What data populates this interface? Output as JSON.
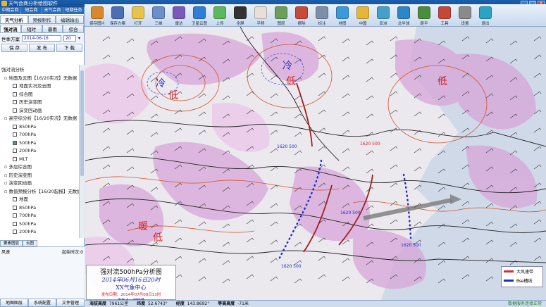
{
  "title": "天气会商分析绘图软件",
  "window_buttons": [
    "_",
    "□",
    "×"
  ],
  "menu": [
    "中期会商",
    "短会商",
    "天气会商",
    "短期任务"
  ],
  "toolbar": [
    {
      "label": "保存图片",
      "icon": "save-image-icon",
      "color": "#d9892b"
    },
    {
      "label": "保存方案",
      "icon": "save-scheme-icon",
      "color": "#4a6fb5"
    },
    {
      "label": "打开",
      "icon": "open-folder-icon",
      "color": "#e6c44a"
    },
    {
      "label": "三维",
      "icon": "3d-icon",
      "color": "#6c8fc9"
    },
    {
      "label": "雷达",
      "icon": "radar-icon",
      "color": "#7a5ab8"
    },
    {
      "label": "卫星云图",
      "icon": "satellite-icon",
      "color": "#2f7ed8"
    },
    {
      "label": "上传",
      "icon": "upload-icon",
      "color": "#5cb85c"
    },
    {
      "label": "全屏",
      "icon": "fullscreen-icon",
      "color": "#333"
    },
    {
      "label": "平移",
      "icon": "pan-hand-icon",
      "color": "#e8e0d8"
    },
    {
      "label": "图层",
      "icon": "layers-icon",
      "color": "#6a9e5a"
    },
    {
      "label": "擦除",
      "icon": "eraser-icon",
      "color": "#c84a3a"
    },
    {
      "label": "标注",
      "icon": "annotate-icon",
      "color": "#7b8fa8"
    },
    {
      "label": "地图",
      "icon": "map-icon",
      "color": "#3b9ad9"
    },
    {
      "label": "中国",
      "icon": "china-map-icon",
      "color": "#e4b73a"
    },
    {
      "label": "亚洲",
      "icon": "asia-map-icon",
      "color": "#44a0c8"
    },
    {
      "label": "北半球",
      "icon": "hemisphere-icon",
      "color": "#2c86c7"
    },
    {
      "label": "距平",
      "icon": "anomaly-icon",
      "color": "#4b8d3c"
    },
    {
      "label": "工具",
      "icon": "tools-icon",
      "color": "#c4473a"
    },
    {
      "label": "设置",
      "icon": "settings-icon",
      "color": "#8a8a8a"
    },
    {
      "label": "退出",
      "icon": "exit-icon",
      "color": "#2aa3c4"
    }
  ],
  "main_tabs": [
    "天气分析",
    "预报制作",
    "编辑输出"
  ],
  "sub_tabs": [
    "强对流",
    "短时",
    "暴雨",
    "综合"
  ],
  "date_label": "世季方案",
  "date_value": "2014-06-16",
  "hour_value": "20",
  "buttons": [
    "保 存",
    "发 布",
    "下 载"
  ],
  "tree": [
    {
      "level": 0,
      "text": "强对流分析"
    },
    {
      "level": 1,
      "text": "地面及云图【16/20实况】无数据"
    },
    {
      "level": 2,
      "text": "地面实况及云图",
      "on": false
    },
    {
      "level": 2,
      "text": "综合图",
      "on": false
    },
    {
      "level": 2,
      "text": "历史演变图",
      "on": false
    },
    {
      "level": 2,
      "text": "演变回动画",
      "on": false
    },
    {
      "level": 1,
      "text": "高空综分析【16/20实况】无数据"
    },
    {
      "level": 2,
      "text": "850hPa",
      "on": false
    },
    {
      "level": 2,
      "text": "700hPa",
      "on": false
    },
    {
      "level": 2,
      "text": "500hPa",
      "on": true
    },
    {
      "level": 2,
      "text": "200hPa",
      "on": false
    },
    {
      "level": 2,
      "text": "MLT",
      "on": false
    },
    {
      "level": 1,
      "text": "多层综合图"
    },
    {
      "level": 1,
      "text": "历史演变图"
    },
    {
      "level": 1,
      "text": "演变回动画"
    },
    {
      "level": 1,
      "text": "数值预报分析【16/20起报】无数据"
    },
    {
      "level": 2,
      "text": "地面",
      "on": false
    },
    {
      "level": 2,
      "text": "850hPa",
      "on": false
    },
    {
      "level": 2,
      "text": "700hPa",
      "on": false
    },
    {
      "level": 2,
      "text": "500hPa",
      "on": false
    },
    {
      "level": 2,
      "text": "200hPa",
      "on": false
    }
  ],
  "prop_tabs": [
    "要素图层",
    "云图"
  ],
  "prop_row": {
    "left": "风速",
    "right": "起始时次:0"
  },
  "bottom_buttons": [
    "地图图层",
    "系统配置",
    "文件管理"
  ],
  "map": {
    "labels": [
      {
        "text": "冷",
        "color": "#1a2ec8",
        "size": 14
      },
      {
        "text": "低",
        "color": "#d22",
        "size": 14
      },
      {
        "text": "冷",
        "color": "#1a2ec8",
        "size": 14
      },
      {
        "text": "低",
        "color": "#d22",
        "size": 14
      },
      {
        "text": "低",
        "color": "#d22",
        "size": 14
      },
      {
        "text": "暖",
        "color": "#d22",
        "size": 14
      },
      {
        "text": "低",
        "color": "#d22",
        "size": 14
      },
      {
        "text": "1620 500",
        "color": "#1a2ec8",
        "size": 6
      },
      {
        "text": "1620 500",
        "color": "#d22",
        "size": 6
      },
      {
        "text": "1620 500",
        "color": "#1a2ec8",
        "size": 6
      },
      {
        "text": "1620 500",
        "color": "#1a2ec8",
        "size": 6
      },
      {
        "text": "1620 500",
        "color": "#1a2ec8",
        "size": 6
      }
    ]
  },
  "caption": {
    "line1": "强对流500hPa分析图",
    "line2": "2014年06月16日20时",
    "line3": "XX气象中心",
    "line4": "发布日期：2014年07月08日13时",
    "line5": "发布人：刘晓燕"
  },
  "legend": [
    {
      "text": "大风速带",
      "color": "#d03030"
    },
    {
      "text": "θse槽线",
      "color": "#1a2ec8"
    }
  ],
  "status": {
    "alt_label": "海拔高度",
    "alt_value": "7961公里",
    "lat_label": "纬度",
    "lat_value": "52.6743°",
    "lon_label": "经度",
    "lon_value": "143.8692°",
    "h_label": "等高高度",
    "h_value": "-71米",
    "conn": "数据服务连接正常"
  }
}
